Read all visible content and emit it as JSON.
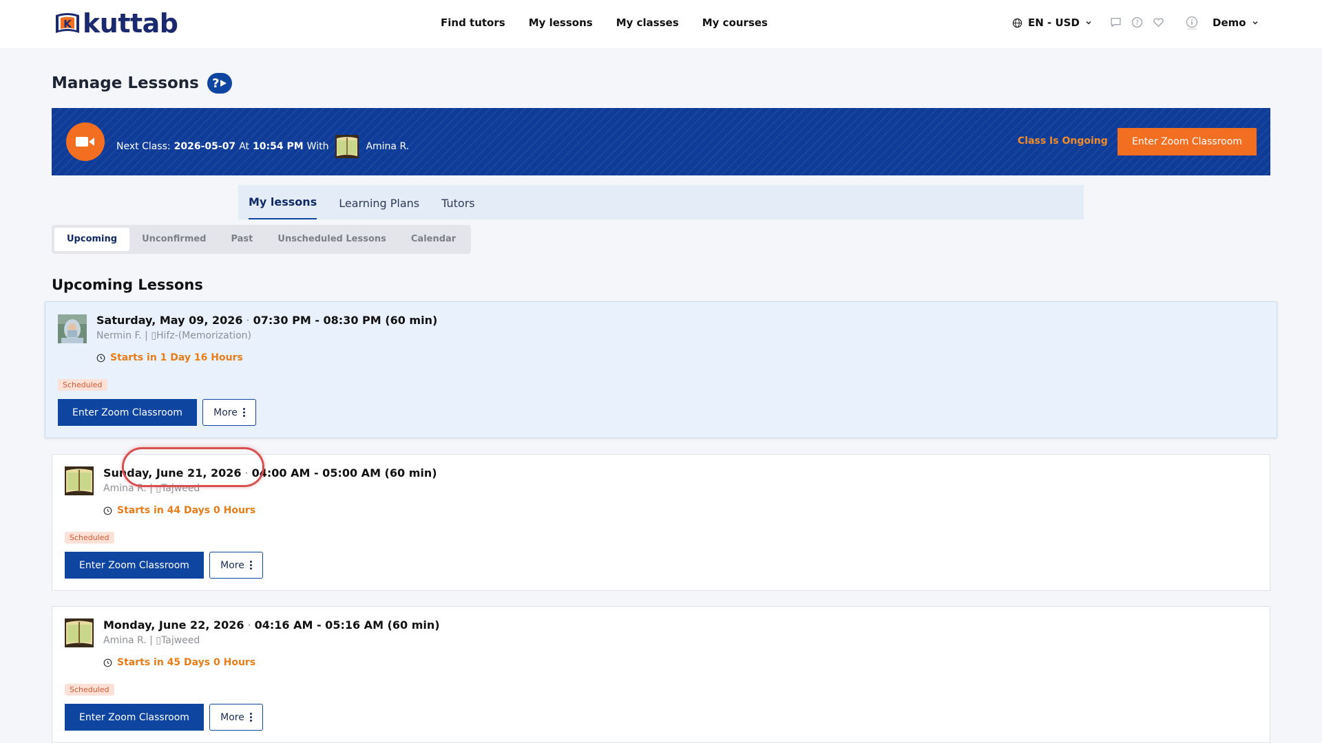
{
  "brand": {
    "name": "kuttab",
    "mark_letter": "K"
  },
  "nav": [
    {
      "label": "Find tutors"
    },
    {
      "label": "My lessons"
    },
    {
      "label": "My classes"
    },
    {
      "label": "My courses"
    }
  ],
  "header": {
    "locale_label": "EN - USD",
    "user_label": "Demo"
  },
  "page": {
    "title": "Manage Lessons",
    "help_label": "?"
  },
  "banner": {
    "prefix": "Next Class:",
    "date": "2026-05-07",
    "at": "At",
    "time": "10:54 PM",
    "with": "With",
    "tutor": "Amina R.",
    "status": "Class Is Ongoing",
    "button": "Enter Zoom Classroom"
  },
  "tabs": [
    {
      "label": "My lessons",
      "active": true
    },
    {
      "label": "Learning Plans",
      "active": false
    },
    {
      "label": "Tutors",
      "active": false
    }
  ],
  "subtabs": [
    {
      "label": "Upcoming",
      "active": true
    },
    {
      "label": "Unconfirmed",
      "active": false
    },
    {
      "label": "Past",
      "active": false
    },
    {
      "label": "Unscheduled Lessons",
      "active": false
    },
    {
      "label": "Calendar",
      "active": false
    }
  ],
  "section_title": "Upcoming Lessons",
  "lessons": [
    {
      "date": "Saturday, May 09, 2026",
      "time": "07:30 PM - 08:30 PM (60 min)",
      "who": "Nermin F. | ▯Hifz-(Memorization)",
      "starts": "Starts in 1 Day 16 Hours",
      "status": "Scheduled",
      "zoom": "Enter Zoom Classroom",
      "more": "More"
    },
    {
      "date": "Sunday, June 21, 2026",
      "time": "04:00 AM - 05:00 AM (60 min)",
      "who": "Amina R. | ▯Tajweed",
      "starts": "Starts in 44 Days 0 Hours",
      "status": "Scheduled",
      "zoom": "Enter Zoom Classroom",
      "more": "More"
    },
    {
      "date": "Monday, June 22, 2026",
      "time": "04:16 AM - 05:16 AM (60 min)",
      "who": "Amina R. | ▯Tajweed",
      "starts": "Starts in 45 Days 0 Hours",
      "status": "Scheduled",
      "zoom": "Enter Zoom Classroom",
      "more": "More"
    }
  ],
  "colors": {
    "primary": "#0e45a0",
    "accent": "#f26e21",
    "warning_text": "#e67d1a",
    "banner_bg": "#0f3c99"
  }
}
